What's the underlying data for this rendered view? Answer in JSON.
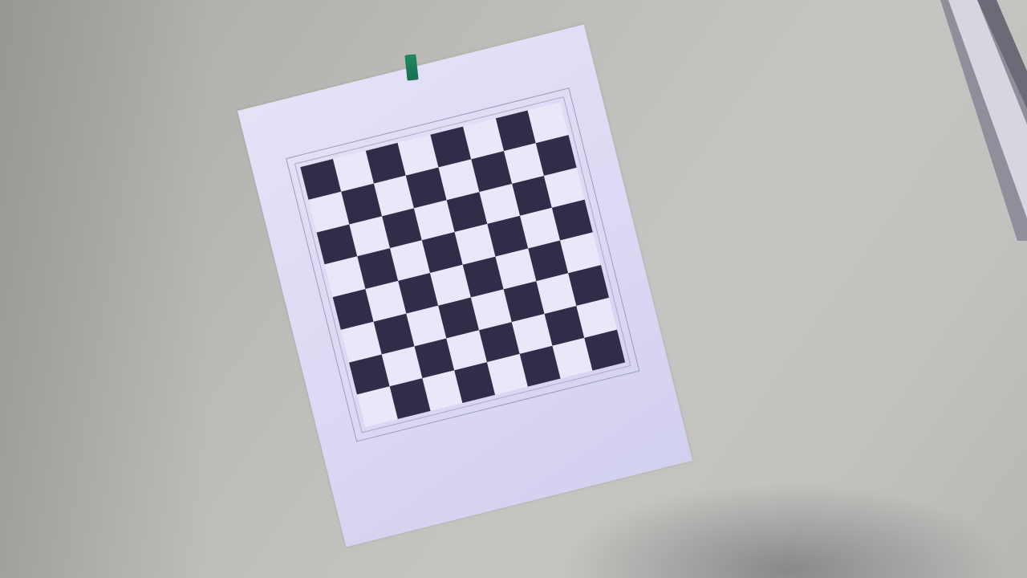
{
  "scene": {
    "subject": "checkerboard",
    "caption_lines": [
      "",
      ""
    ]
  },
  "board": {
    "rows": 8,
    "cols": 8,
    "dark_color": "#2f2d47",
    "light_color": "#e9e7fa"
  },
  "colors": {
    "wall": "#c2c0bc",
    "paper": "#dcdaf4",
    "tape": "#1f8a5e"
  }
}
